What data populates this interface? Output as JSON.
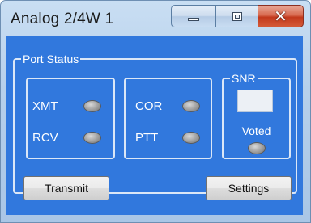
{
  "window": {
    "title": "Analog 2/4W 1"
  },
  "caption_buttons": {
    "minimize": "minimize-icon",
    "maximize": "maximize-icon",
    "close": "close-icon"
  },
  "port_status": {
    "label": "Port Status",
    "group1": [
      {
        "label": "XMT",
        "indicator": "off"
      },
      {
        "label": "RCV",
        "indicator": "off"
      }
    ],
    "group2": [
      {
        "label": "COR",
        "indicator": "off"
      },
      {
        "label": "PTT",
        "indicator": "off"
      }
    ],
    "snr": {
      "label": "SNR",
      "value": "",
      "voted_label": "Voted",
      "voted_indicator": "off"
    }
  },
  "buttons": {
    "transmit": "Transmit",
    "settings": "Settings"
  },
  "colors": {
    "client_bg": "#3178dd",
    "led_off": "#a8a8a8",
    "close_button": "#c2391c"
  }
}
